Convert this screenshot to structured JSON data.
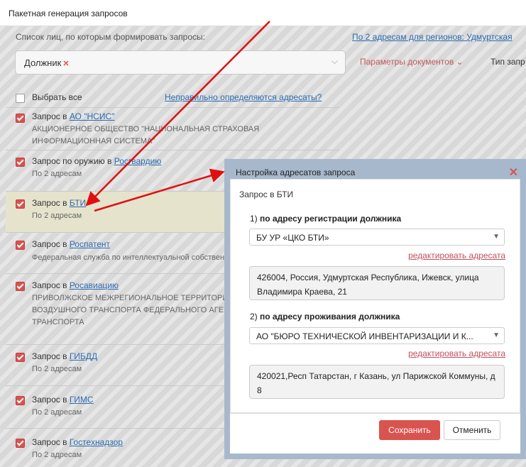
{
  "window": {
    "title": "Пакетная генерация запросов"
  },
  "filter": {
    "label": "Список лиц, по которым формировать запросы:",
    "regions_link": "По 2 адресам для регионов: Удмуртская",
    "tag": "Должник",
    "params_label": "Параметры документов",
    "type_label": "Тип запр"
  },
  "list": {
    "select_all": "Выбрать все",
    "wrong_addr_link": "Неправильно определяются адресаты?",
    "items": [
      {
        "prefix": "Запрос в ",
        "link": "АО \"НСИС\"",
        "sub": "АКЦИОНЕРНОЕ ОБЩЕСТВО \"НАЦИОНАЛЬНАЯ СТРАХОВАЯ ИНФОРМАЦИОННАЯ СИСТЕМА\""
      },
      {
        "prefix": "Запрос по оружию в ",
        "link": "Росгвардию",
        "sub": "По 2 адресам"
      },
      {
        "prefix": "Запрос в ",
        "link": "БТИ",
        "sub": "По 2 адресам"
      },
      {
        "prefix": "Запрос в ",
        "link": "Роспатент",
        "sub": "Федеральная служба по интеллектуальной собственности"
      },
      {
        "prefix": "Запрос в ",
        "link": "Росавиацию",
        "sub": "ПРИВОЛЖСКОЕ МЕЖРЕГИОНАЛЬНОЕ ТЕРРИТОРИАЛЬНОЕ УПРАВЛЕНИЕ ВОЗДУШНОГО ТРАНСПОРТА ФЕДЕРАЛЬНОГО АГЕНТСТВА ВОЗДУШНОГО ТРАНСПОРТА"
      },
      {
        "prefix": "Запрос в ",
        "link": "ГИБДД",
        "sub": "По 2 адресам"
      },
      {
        "prefix": "Запрос в ",
        "link": "ГИМС",
        "sub": "По 2 адресам"
      },
      {
        "prefix": "Запрос в ",
        "link": "Гостехнадзор",
        "sub": "По 2 адресам"
      }
    ]
  },
  "modal": {
    "title": "Настройка адресатов запроса",
    "subtitle": "Запрос в БТИ",
    "section1": {
      "num": "1) ",
      "label": "по адресу регистрации должника",
      "select": "БУ УР «ЦКО БТИ»",
      "edit": "редактировать адресата",
      "address": "426004, Россия, Удмуртская Республика, Ижевск, улица Владимира Краева, 21"
    },
    "section2": {
      "num": "2) ",
      "label": "по адресу проживания должника",
      "select": "АО \"БЮРО ТЕХНИЧЕСКОЙ ИНВЕНТАРИЗАЦИИ И К...",
      "edit": "редактировать адресата",
      "address": "420021,Респ Татарстан, г Казань, ул Парижской Коммуны, д 8"
    },
    "save": "Сохранить",
    "cancel": "Отменить"
  },
  "colors": {
    "accent": "#d9534f",
    "link": "#2b6cb0",
    "arrow": "#e01010"
  }
}
